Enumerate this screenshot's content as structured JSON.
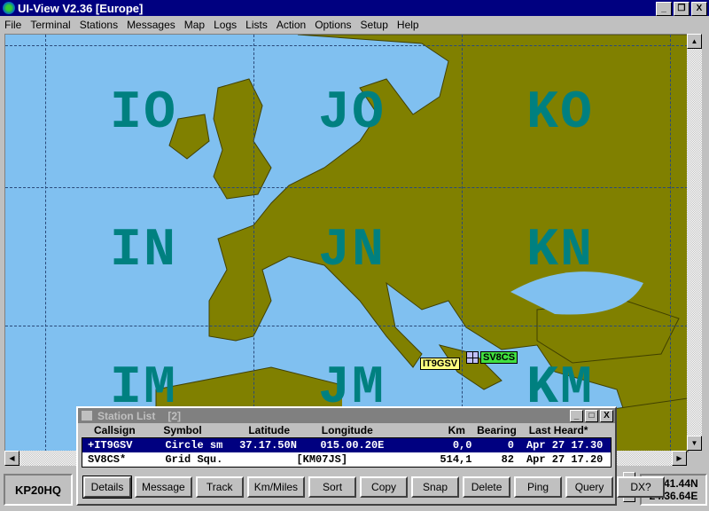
{
  "window": {
    "title": "UI-View V2.36 [Europe]",
    "min": "_",
    "max": "❐",
    "close": "X"
  },
  "menu": [
    "File",
    "Terminal",
    "Stations",
    "Messages",
    "Map",
    "Logs",
    "Lists",
    "Action",
    "Options",
    "Setup",
    "Help"
  ],
  "map": {
    "grid_labels": [
      "IO",
      "JO",
      "KO",
      "IN",
      "JN",
      "KN",
      "IM",
      "JM",
      "KM"
    ],
    "stations": [
      {
        "call": "IT9GSV",
        "color": "#ffff80"
      },
      {
        "call": "SV8CS",
        "color": "#40e040"
      }
    ],
    "sea_color": "#80c0f0",
    "land_color": "#808000"
  },
  "station_list": {
    "title": "Station List",
    "count": "[2]",
    "columns": [
      "Callsign",
      "Symbol",
      "Latitude",
      "Longitude",
      "Km",
      "Bearing",
      "Last Heard*"
    ],
    "rows": [
      [
        "+IT9GSV",
        "Circle sm",
        "37.17.50N",
        "015.00.20E",
        "0,0",
        "0",
        "Apr 27 17.30"
      ],
      [
        "SV8CS*",
        "Grid Squ.",
        "[KM07JS]",
        "",
        "514,1",
        "82",
        "Apr 27 17.20"
      ]
    ],
    "buttons": [
      "Details",
      "Message",
      "Track",
      "Km/Miles",
      "Sort",
      "Copy",
      "Snap",
      "Delete",
      "Ping",
      "Query",
      "DX?"
    ]
  },
  "status": {
    "locator": "KP20HQ",
    "lat": "60.41.44N",
    "lon": "24.36.64E"
  }
}
